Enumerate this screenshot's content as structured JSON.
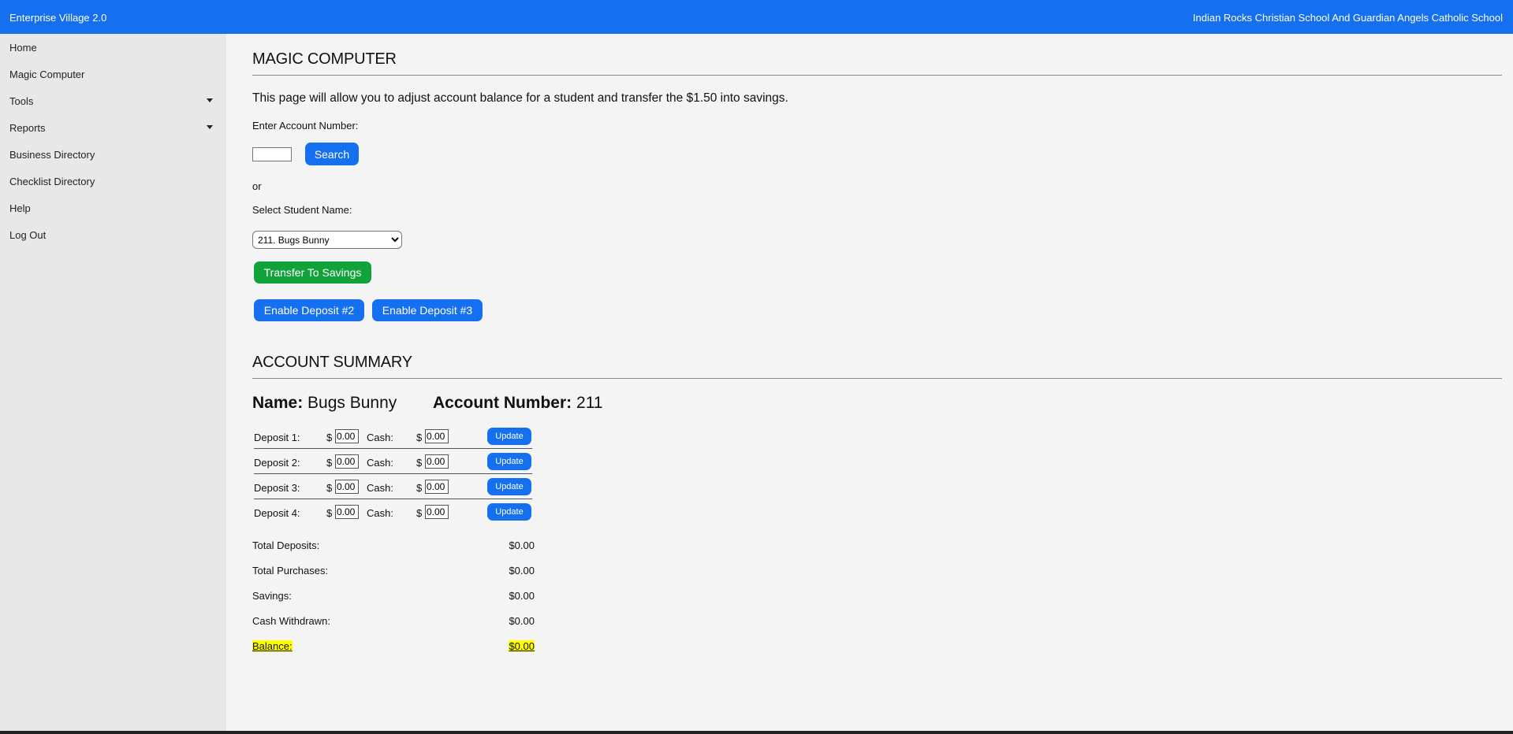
{
  "header": {
    "brand": "Enterprise Village 2.0",
    "school": "Indian Rocks Christian School And Guardian Angels Catholic School"
  },
  "sidebar": {
    "items": [
      {
        "label": "Home"
      },
      {
        "label": "Magic Computer"
      },
      {
        "label": "Tools",
        "has_dropdown": true
      },
      {
        "label": "Reports",
        "has_dropdown": true
      },
      {
        "label": "Business Directory"
      },
      {
        "label": "Checklist Directory"
      },
      {
        "label": "Help"
      },
      {
        "label": "Log Out"
      }
    ]
  },
  "main": {
    "title": "MAGIC COMPUTER",
    "intro": "This page will allow you to adjust account balance for a student and transfer the $1.50 into savings.",
    "account_label": "Enter Account Number:",
    "account_value": "",
    "search_button": "Search",
    "or_text": "or",
    "select_label": "Select Student Name:",
    "selected_student": "211. Bugs Bunny",
    "transfer_button": "Transfer To Savings",
    "enable2_button": "Enable Deposit #2",
    "enable3_button": "Enable Deposit #3"
  },
  "summary": {
    "title": "ACCOUNT SUMMARY",
    "name_label": "Name:",
    "name_value": "Bugs Bunny",
    "account_label": "Account Number:",
    "account_value": "211",
    "deposits": [
      {
        "label": "Deposit 1:",
        "currency": "$",
        "amount": "0.00",
        "cash_label": "Cash:",
        "cash": "0.00",
        "button": "Update"
      },
      {
        "label": "Deposit 2:",
        "currency": "$",
        "amount": "0.00",
        "cash_label": "Cash:",
        "cash": "0.00",
        "button": "Update"
      },
      {
        "label": "Deposit 3:",
        "currency": "$",
        "amount": "0.00",
        "cash_label": "Cash:",
        "cash": "0.00",
        "button": "Update"
      },
      {
        "label": "Deposit 4:",
        "currency": "$",
        "amount": "0.00",
        "cash_label": "Cash:",
        "cash": "0.00",
        "button": "Update"
      }
    ],
    "totals": [
      {
        "label": "Total Deposits:",
        "value": "$0.00"
      },
      {
        "label": "Total Purchases:",
        "value": "$0.00"
      },
      {
        "label": "Savings:",
        "value": "$0.00"
      },
      {
        "label": "Cash Withdrawn:",
        "value": "$0.00"
      },
      {
        "label": "Balance:",
        "value": "$0.00",
        "highlight": true
      }
    ]
  },
  "colors": {
    "primary": "#1570ef",
    "success": "#12a23b",
    "highlight": "#ffff00",
    "sidebar_bg": "#e8e8e8",
    "page_bg": "#f4f4f4"
  }
}
